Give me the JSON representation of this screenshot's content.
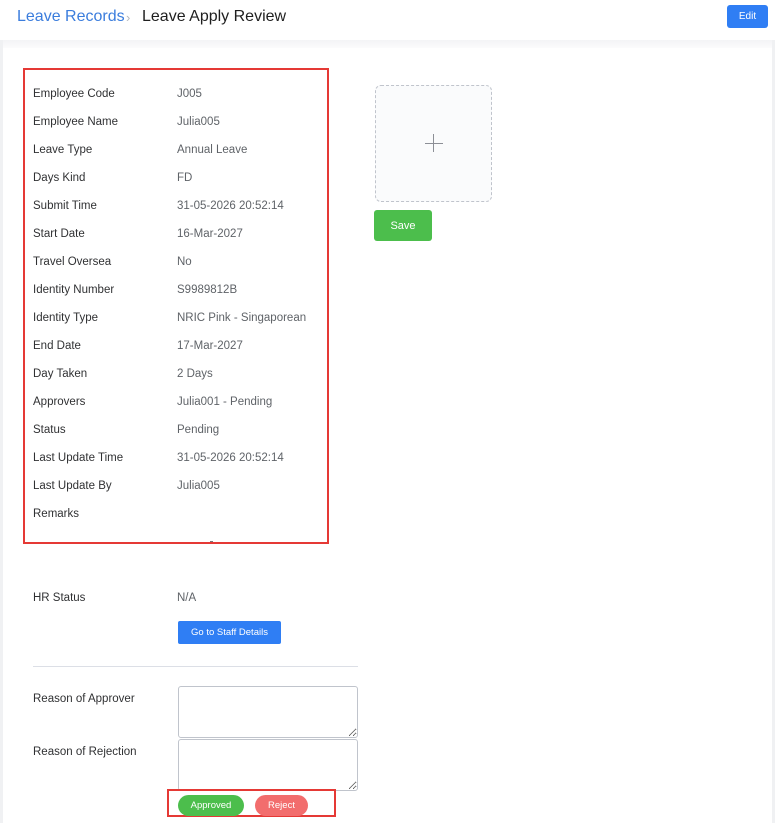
{
  "header": {
    "breadcrumb_link": "Leave Records",
    "breadcrumb_separator": "›",
    "breadcrumb_current": "Leave Apply Review",
    "edit_label": "Edit"
  },
  "details": {
    "rows": [
      {
        "label": "Employee Code",
        "value": "J005"
      },
      {
        "label": "Employee Name",
        "value": "Julia005"
      },
      {
        "label": "Leave Type",
        "value": "Annual Leave"
      },
      {
        "label": "Days Kind",
        "value": "FD"
      },
      {
        "label": "Submit Time",
        "value": "31-05-2026 20:52:14"
      },
      {
        "label": "Start Date",
        "value": "16-Mar-2027"
      },
      {
        "label": "Travel Oversea",
        "value": "No"
      },
      {
        "label": "Identity Number",
        "value": "S9989812B"
      },
      {
        "label": "Identity Type",
        "value": "NRIC Pink - Singaporean"
      },
      {
        "label": "End Date",
        "value": "17-Mar-2027"
      },
      {
        "label": "Day Taken",
        "value": "2 Days"
      },
      {
        "label": "Approvers",
        "value": "Julia001 - Pending"
      },
      {
        "label": "Status",
        "value": "Pending"
      },
      {
        "label": "Last Update Time",
        "value": "31-05-2026 20:52:14"
      },
      {
        "label": "Last Update By",
        "value": "Julia005"
      },
      {
        "label": "Remarks",
        "value": ""
      }
    ]
  },
  "upload": {
    "icon": "plus-icon",
    "save_label": "Save"
  },
  "hr": {
    "label": "HR Status",
    "value": "N/A",
    "staff_button_label": "Go to Staff Details"
  },
  "reasons": {
    "approver_label": "Reason of Approver",
    "approver_value": "",
    "rejection_label": "Reason of Rejection",
    "rejection_value": ""
  },
  "actions": {
    "approve_label": "Approved",
    "reject_label": "Reject"
  },
  "colors": {
    "primary": "#2f7ef4",
    "success": "#4cbe4c",
    "danger": "#f26d6d",
    "highlight_border": "#e53935",
    "link": "#3b7ddd"
  }
}
